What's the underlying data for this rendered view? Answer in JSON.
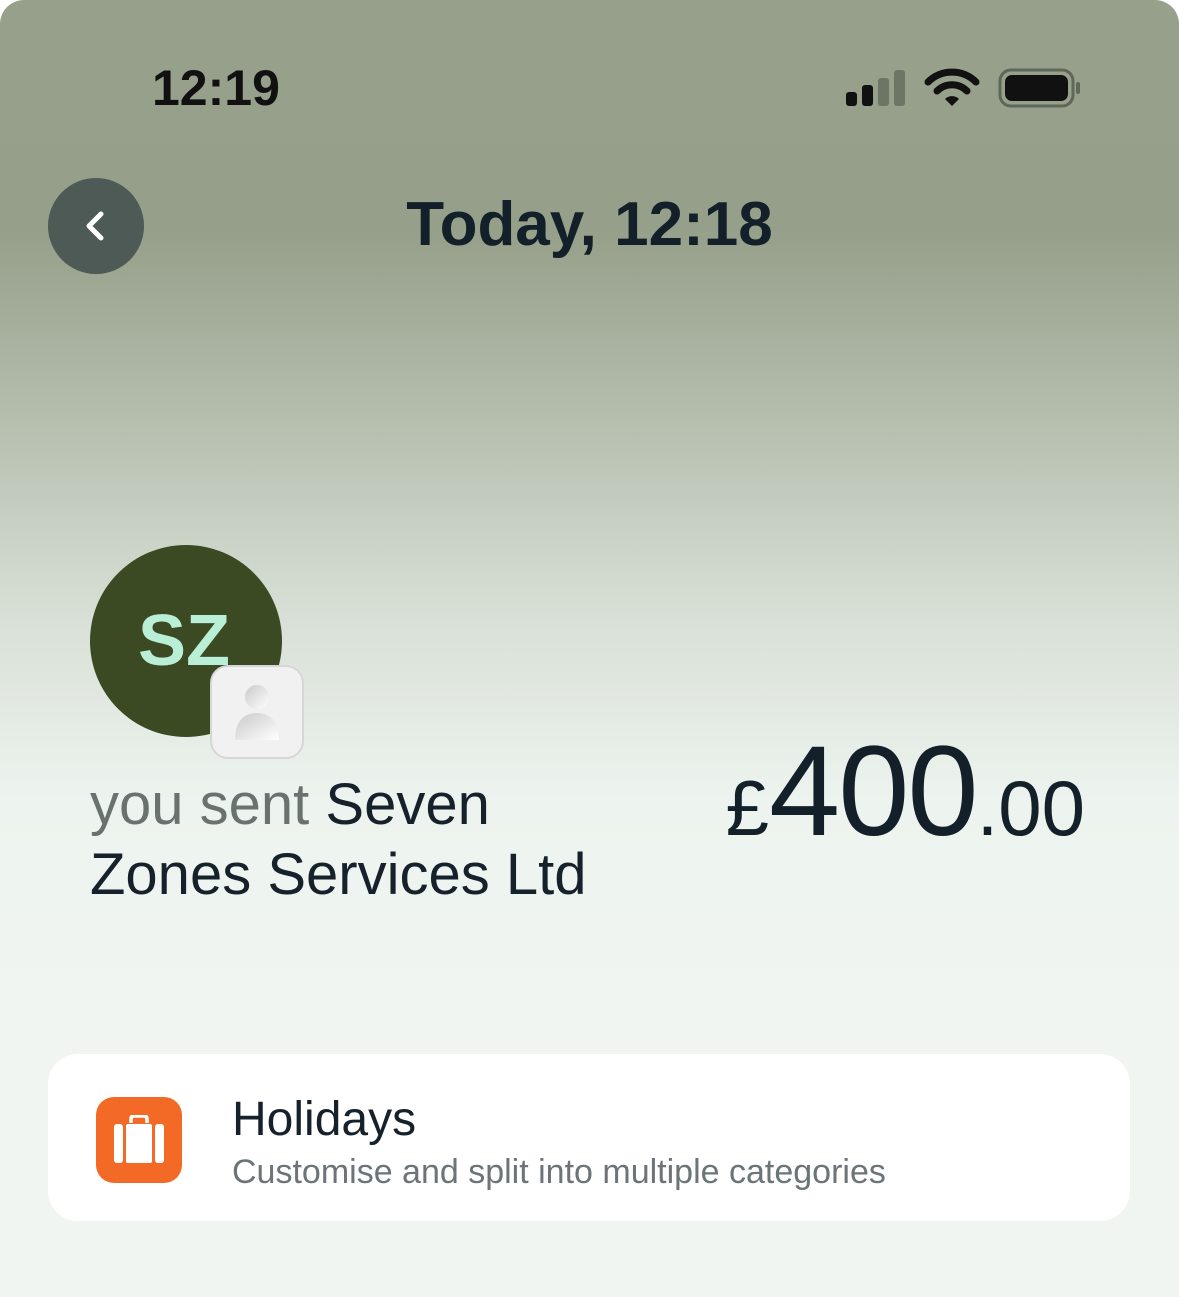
{
  "status_bar": {
    "time": "12:19",
    "signal_icon": "cellular-signal-icon",
    "wifi_icon": "wifi-icon",
    "battery_icon": "battery-icon"
  },
  "header": {
    "back_icon": "chevron-left-icon",
    "title": "Today, 12:18"
  },
  "transaction": {
    "avatar_initials": "SZ",
    "avatar_color": "#3b4a23",
    "avatar_text_color": "#b9efd7",
    "contact_icon": "person-icon",
    "prefix": "you sent",
    "recipient": "Seven Zones Services Ltd",
    "amount": {
      "currency": "£",
      "whole": "400",
      "decimal": ".00"
    }
  },
  "category": {
    "icon": "suitcase-icon",
    "icon_color": "#f26a25",
    "title": "Holidays",
    "subtitle": "Customise and split into multiple categories"
  }
}
